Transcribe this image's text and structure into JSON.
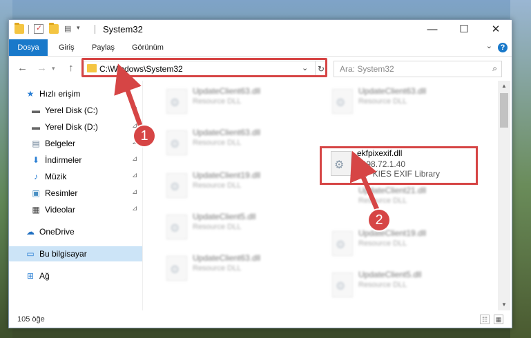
{
  "window": {
    "title": "System32",
    "controls": {
      "minimize": "—",
      "maximize": "☐",
      "close": "✕"
    }
  },
  "ribbon": {
    "tabs": [
      "Dosya",
      "Giriş",
      "Paylaş",
      "Görünüm"
    ],
    "help": "?"
  },
  "address": {
    "path": "C:\\Windows\\System32",
    "search_placeholder": "Ara: System32"
  },
  "sidebar": {
    "items": [
      {
        "label": "Hızlı erişim",
        "icon": "star-icon"
      },
      {
        "label": "Yerel Disk (C:)",
        "icon": "drive-icon"
      },
      {
        "label": "Yerel Disk (D:)",
        "icon": "drive-icon"
      },
      {
        "label": "Belgeler",
        "icon": "documents-icon"
      },
      {
        "label": "İndirmeler",
        "icon": "download-icon"
      },
      {
        "label": "Müzik",
        "icon": "music-icon"
      },
      {
        "label": "Resimler",
        "icon": "pictures-icon"
      },
      {
        "label": "Videolar",
        "icon": "videos-icon"
      },
      {
        "label": "OneDrive",
        "icon": "cloud-icon"
      },
      {
        "label": "Bu bilgisayar",
        "icon": "computer-icon"
      },
      {
        "label": "Ağ",
        "icon": "network-icon"
      }
    ]
  },
  "files": {
    "left": [
      {
        "name": "UpdateClient63.dll",
        "desc": "Resource DLL"
      },
      {
        "name": "UpdateClient63.dll",
        "desc": "Resource DLL"
      },
      {
        "name": "UpdateClient19.dll",
        "desc": "Resource DLL"
      },
      {
        "name": "UpdateClient5.dll",
        "desc": "Resource DLL"
      },
      {
        "name": "UpdateClient63.dll",
        "desc": "Resource DLL"
      }
    ],
    "right": [
      {
        "name": "UpdateClient63.dll",
        "desc": "Resource DLL"
      },
      {
        "name": "UpdateClient21.dll",
        "desc": "Resource DLL"
      },
      {
        "name": "UpdateClient19.dll",
        "desc": "Resource DLL"
      },
      {
        "name": "UpdateClient5.dll",
        "desc": "Resource DLL"
      }
    ],
    "selected": {
      "name": "ekfpixexif.dll",
      "version": "1998.72.1.40",
      "desc": "NIF KIES EXIF Library"
    }
  },
  "status": {
    "count": "105 öğe"
  },
  "annotations": {
    "step1": "1",
    "step2": "2",
    "color": "#d64545"
  }
}
